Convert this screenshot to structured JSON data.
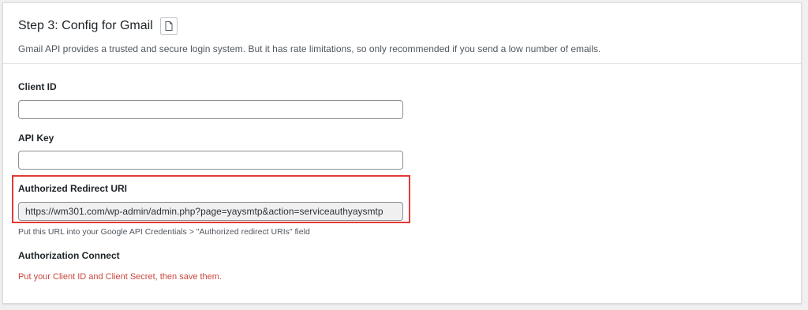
{
  "header": {
    "title": "Step 3: Config for Gmail",
    "doc_icon": "document-icon",
    "subtitle": "Gmail API provides a trusted and secure login system. But it has rate limitations, so only recommended if you send a low number of emails."
  },
  "fields": {
    "client_id": {
      "label": "Client ID",
      "value": "",
      "placeholder": ""
    },
    "api_key": {
      "label": "API Key",
      "value": "",
      "placeholder": ""
    },
    "redirect_uri": {
      "label": "Authorized Redirect URI",
      "value": "https://wm301.com/wp-admin/admin.php?page=yaysmtp&action=serviceauthyaysmtp",
      "hint": "Put this URL into your Google API Credentials > \"Authorized redirect URIs\" field"
    },
    "authorization": {
      "label": "Authorization Connect",
      "message": "Put your Client ID and Client Secret, then save them."
    }
  },
  "colors": {
    "highlight_border": "#e53935",
    "error_text": "#c9463d"
  }
}
